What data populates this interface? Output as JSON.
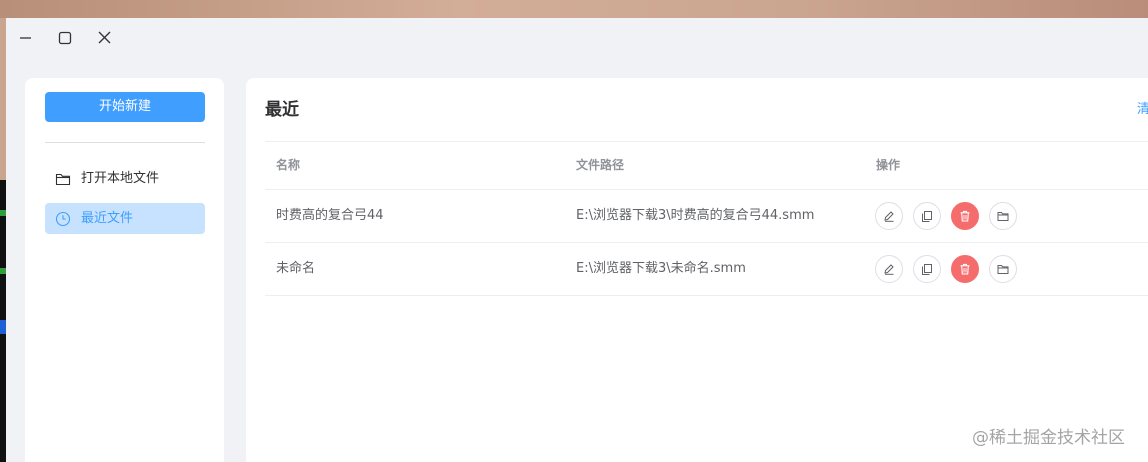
{
  "sidebar": {
    "new_button": "开始新建",
    "items": [
      {
        "label": "打开本地文件",
        "icon": "folder-icon",
        "active": false
      },
      {
        "label": "最近文件",
        "icon": "clock-icon",
        "active": true
      }
    ]
  },
  "main": {
    "title": "最近",
    "clear_link": "清",
    "columns": {
      "name": "名称",
      "path": "文件路径",
      "ops": "操作"
    },
    "rows": [
      {
        "name": "时费高的复合弓44",
        "path": "E:\\浏览器下载3\\时费高的复合弓44.smm"
      },
      {
        "name": "未命名",
        "path": "E:\\浏览器下载3\\未命名.smm"
      }
    ],
    "row_actions": [
      "edit-icon",
      "copy-icon",
      "delete-icon",
      "open-folder-icon"
    ]
  },
  "colors": {
    "primary": "#409eff",
    "active_bg": "#c6e2ff",
    "danger": "#f56c6c"
  },
  "watermark": "@稀土掘金技术社区"
}
